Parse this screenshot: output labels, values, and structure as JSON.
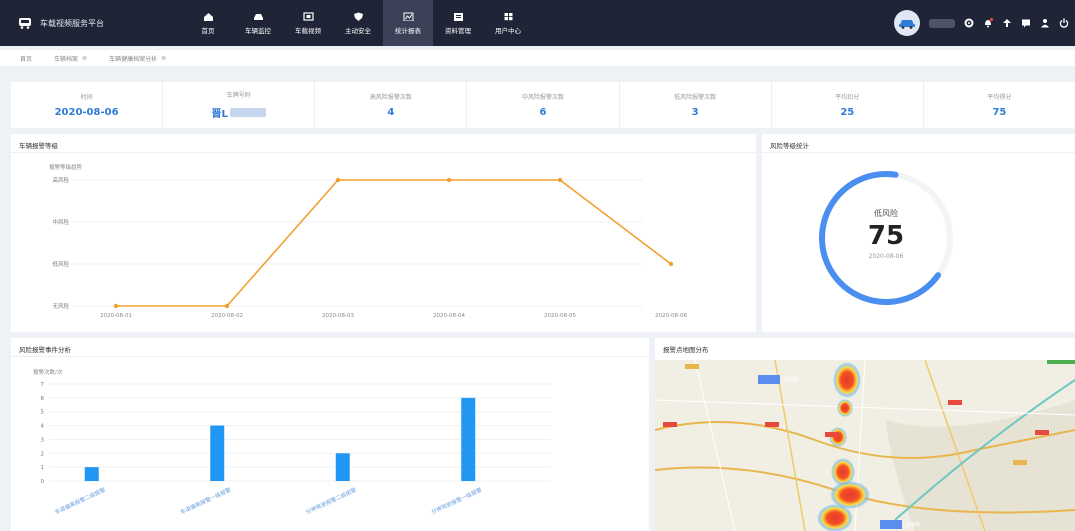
{
  "app": {
    "title": "车载视频服务平台"
  },
  "nav": [
    {
      "label": "首页",
      "icon": "home-icon"
    },
    {
      "label": "车辆监控",
      "icon": "car-icon"
    },
    {
      "label": "车载视频",
      "icon": "video-icon"
    },
    {
      "label": "主动安全",
      "icon": "shield-icon"
    },
    {
      "label": "统计报表",
      "icon": "report-icon",
      "active": true
    },
    {
      "label": "资料管理",
      "icon": "folder-icon"
    },
    {
      "label": "用户中心",
      "icon": "grid-icon"
    }
  ],
  "right_tools": [
    "gear-icon",
    "bell-icon",
    "upload-icon",
    "message-icon",
    "user-icon",
    "power-icon"
  ],
  "breadcrumb": [
    {
      "label": "首页",
      "closable": false
    },
    {
      "label": "车辆档案",
      "closable": true
    },
    {
      "label": "车辆健康档案分析",
      "closable": true
    }
  ],
  "stats": [
    {
      "label": "时间",
      "value": "2020-08-06"
    },
    {
      "label": "车牌号码",
      "value": "晋L"
    },
    {
      "label": "高风险报警次数",
      "value": "4"
    },
    {
      "label": "中风险报警次数",
      "value": "6"
    },
    {
      "label": "低风险报警次数",
      "value": "3"
    },
    {
      "label": "平均扣分",
      "value": "25"
    },
    {
      "label": "平均得分",
      "value": "75"
    }
  ],
  "panels": {
    "trend": {
      "title": "车辆报警等级"
    },
    "risk": {
      "title": "风险等级统计",
      "level": "低风险",
      "score": "75",
      "date": "2020-08-06",
      "gauge_fraction": 0.75
    },
    "events": {
      "title": "风险报警事件分析"
    },
    "map": {
      "title": "报警点地图分布"
    }
  },
  "chart_data": [
    {
      "type": "line",
      "title": "",
      "ylabel": "报警等级趋势",
      "x": [
        "2020-08-01",
        "2020-08-02",
        "2020-08-03",
        "2020-08-04",
        "2020-08-05",
        "2020-08-06"
      ],
      "y_categories": [
        "无风险",
        "低风险",
        "中风险",
        "高风险"
      ],
      "values": [
        0,
        0,
        3,
        3,
        3,
        1
      ],
      "color": "#f0a030"
    },
    {
      "type": "bar",
      "title": "",
      "ylabel": "报警次数/次",
      "categories": [
        "车道偏离报警二级报警",
        "车道偏离报警一级报警",
        "分神驾驶报警二级报警",
        "分神驾驶报警一级报警"
      ],
      "values": [
        1,
        4,
        2,
        6
      ],
      "ylim": [
        0,
        7
      ],
      "yticks": [
        0,
        1,
        2,
        3,
        4,
        5,
        6,
        7
      ],
      "color": "#2196f3"
    }
  ],
  "map": {
    "labels": [
      "迎宾路",
      "冶金路"
    ]
  }
}
